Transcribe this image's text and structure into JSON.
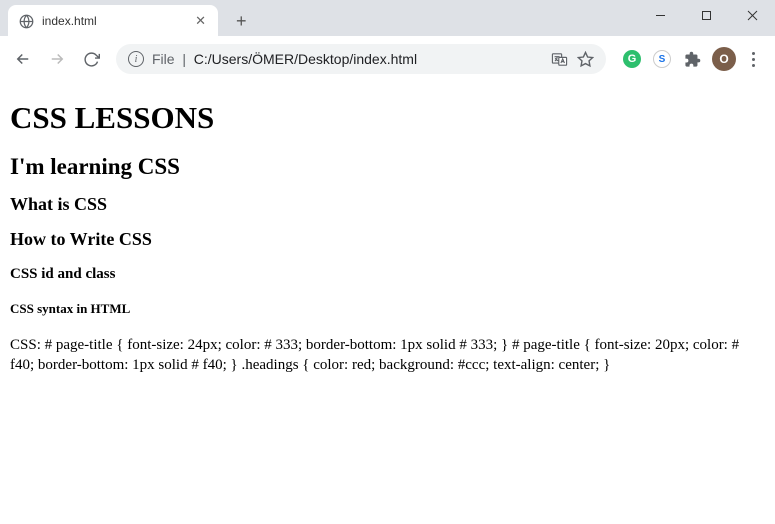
{
  "tab": {
    "title": "index.html"
  },
  "address": {
    "prefix": "File",
    "separator": "|",
    "path": "C:/Users/ÖMER/Desktop/index.html"
  },
  "avatar": {
    "letter": "O"
  },
  "page": {
    "h1": "CSS LESSONS",
    "h2": "I'm learning CSS",
    "h3": "What is CSS",
    "h4": "How to Write CSS",
    "h5_1": "CSS id and class",
    "h5_2": "CSS syntax in HTML",
    "body_text": "CSS: # page-title { font-size: 24px; color: # 333; border-bottom: 1px solid # 333; } # page-title { font-size: 20px; color: # f40; border-bottom: 1px solid # f40; } .headings { color: red; background: #ccc; text-align: center; }"
  }
}
